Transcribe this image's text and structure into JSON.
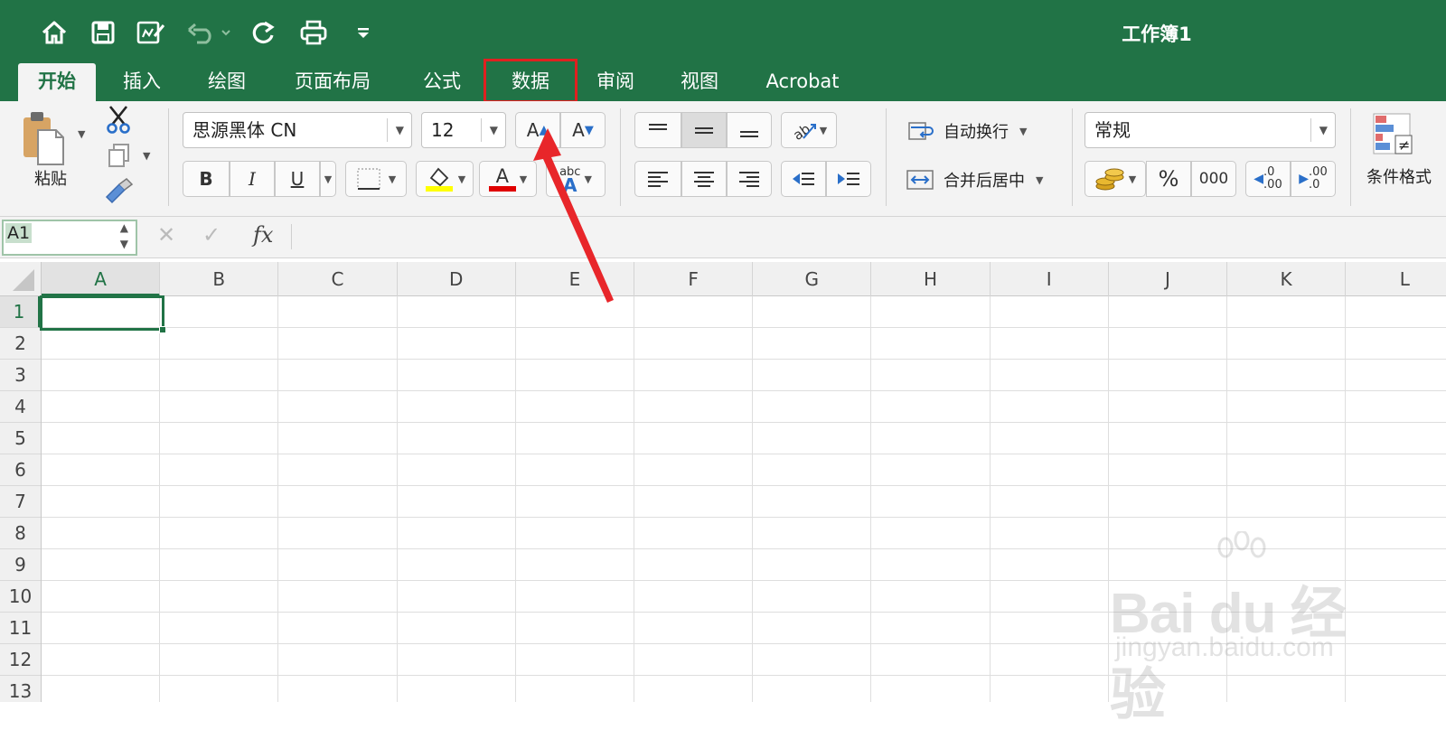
{
  "window": {
    "title": "工作簿1"
  },
  "quick_access": {
    "icons": [
      "home-icon",
      "save-icon",
      "edit-document-icon",
      "undo-icon",
      "redo-icon",
      "print-icon",
      "customize-icon"
    ]
  },
  "tabs": [
    {
      "label": "开始",
      "active": true
    },
    {
      "label": "插入"
    },
    {
      "label": "绘图"
    },
    {
      "label": "页面布局"
    },
    {
      "label": "公式"
    },
    {
      "label": "数据",
      "highlighted": true
    },
    {
      "label": "审阅"
    },
    {
      "label": "视图"
    },
    {
      "label": "Acrobat"
    }
  ],
  "ribbon": {
    "paste_label": "粘贴",
    "font_name": "思源黑体 CN",
    "font_size": "12",
    "bold": "B",
    "italic": "I",
    "underline": "U",
    "grow_font": "A",
    "shrink_font": "A",
    "font_color_glyph": "A",
    "phonetic_top": "abc",
    "phonetic_bottom": "A",
    "wrap_text_label": "自动换行",
    "merge_center_label": "合并后居中",
    "number_format": "常规",
    "percent": "%",
    "thousands": "000",
    "decrease_decimal_top": ".0",
    "decrease_decimal_bottom": ".00",
    "increase_decimal_top": ".00",
    "increase_decimal_bottom": ".0",
    "conditional_format_label": "条件格式",
    "fill_color": "#ffff00",
    "font_color": "#e00000"
  },
  "formula_bar": {
    "name_box": "A1",
    "cancel_glyph": "✕",
    "enter_glyph": "✓",
    "fx_label": "fx",
    "value": ""
  },
  "sheet": {
    "columns": [
      "A",
      "B",
      "C",
      "D",
      "E",
      "F",
      "G",
      "H",
      "I",
      "J",
      "K",
      "L"
    ],
    "rows": [
      "1",
      "2",
      "3",
      "4",
      "5",
      "6",
      "7",
      "8",
      "9",
      "10",
      "11",
      "12",
      "13"
    ],
    "selected_cell": "A1"
  },
  "watermark": {
    "main": "Bai du 经验",
    "sub": "jingyan.baidu.com"
  },
  "colors": {
    "accent": "#217346",
    "highlight_box": "#e02020",
    "arrow": "#e8262a"
  }
}
